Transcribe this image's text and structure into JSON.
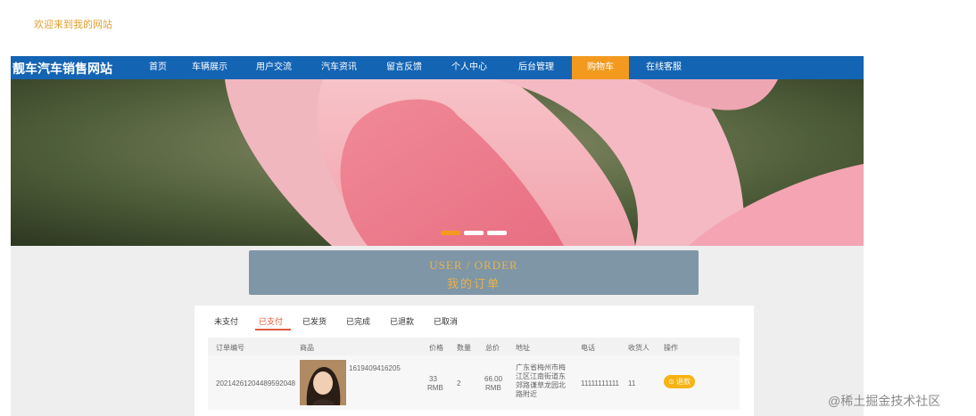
{
  "top": {
    "welcome": "欢迎来到我的网站"
  },
  "nav": {
    "brand": "靓车汽车销售网站",
    "items": [
      {
        "label": "首页"
      },
      {
        "label": "车辆展示"
      },
      {
        "label": "用户交流"
      },
      {
        "label": "汽车资讯"
      },
      {
        "label": "留言反馈"
      },
      {
        "label": "个人中心"
      },
      {
        "label": "后台管理"
      },
      {
        "label": "购物车"
      },
      {
        "label": "在线客服"
      }
    ],
    "active_index": 7
  },
  "order_header": {
    "title_en": "USER / ORDER",
    "title_cn": "我的订单"
  },
  "tabs": [
    {
      "label": "未支付"
    },
    {
      "label": "已支付"
    },
    {
      "label": "已发货"
    },
    {
      "label": "已完成"
    },
    {
      "label": "已退款"
    },
    {
      "label": "已取消"
    }
  ],
  "active_tab": 1,
  "table": {
    "columns": [
      "订单编号",
      "商品",
      "价格",
      "数量",
      "总价",
      "地址",
      "电话",
      "收货人",
      "操作"
    ],
    "row": {
      "order_no": "20214261204489592048",
      "product_code": "1619409416205",
      "price_num": "33",
      "price_unit": "RMB",
      "quantity": "2",
      "total_num": "66.00",
      "total_unit": "RMB",
      "address_lines": [
        "广东省梅州市梅",
        "江区江南街道东",
        "郊路谦草龙园北",
        "路附近"
      ],
      "phone": "11111111111",
      "receiver": "11",
      "action_label": "退款"
    }
  },
  "watermark": "@稀土掘金技术社区",
  "colors": {
    "nav": "#1464b4",
    "accent": "#f39a1e",
    "tab_active": "#e05a3a",
    "header_bg": "#7f96a6",
    "header_text": "#e8b24a",
    "pay_button": "#f6b312"
  }
}
